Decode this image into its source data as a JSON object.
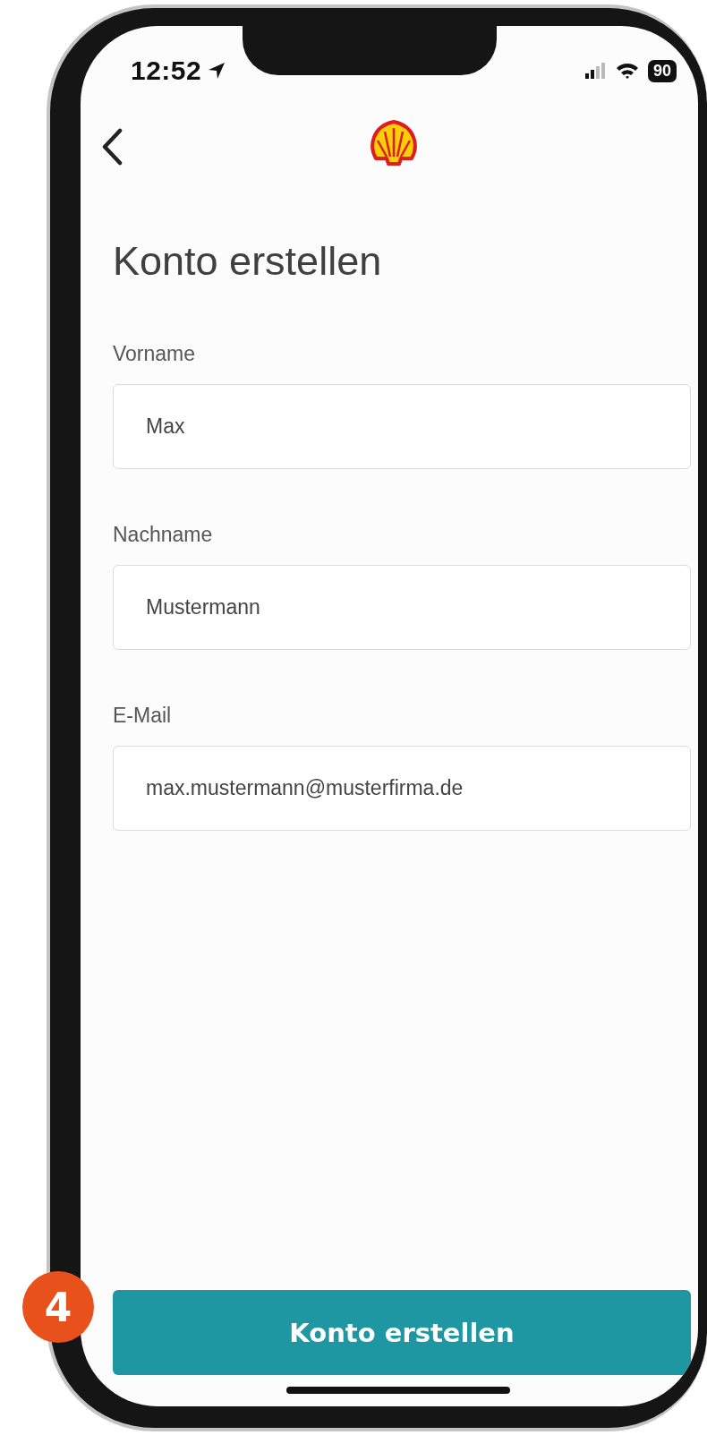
{
  "status_bar": {
    "time": "12:52",
    "battery": "90"
  },
  "header": {
    "title": "Konto erstellen"
  },
  "fields": [
    {
      "label": "Vorname",
      "value": "Max"
    },
    {
      "label": "Nachname",
      "value": "Mustermann"
    },
    {
      "label": "E-Mail",
      "value": "max.mustermann@musterfirma.de"
    }
  ],
  "button": {
    "label": "Konto erstellen"
  },
  "step_badge": {
    "number": "4"
  }
}
